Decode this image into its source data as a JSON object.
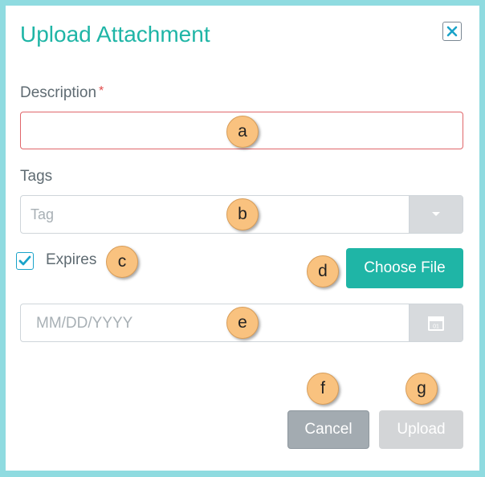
{
  "dialog": {
    "title": "Upload Attachment",
    "close_icon": "close-x-icon"
  },
  "form": {
    "description_label": "Description",
    "required_mark": "*",
    "description_value": "",
    "tags_label": "Tags",
    "tags_placeholder": "Tag",
    "expires_label": "Expires",
    "expires_checked": true,
    "choose_file_label": "Choose File",
    "date_placeholder": "MM/DD/YYYY",
    "calendar_icon_text": "01"
  },
  "footer": {
    "cancel_label": "Cancel",
    "upload_label": "Upload"
  },
  "annotations": {
    "a": "a",
    "b": "b",
    "c": "c",
    "d": "d",
    "e": "e",
    "f": "f",
    "g": "g"
  },
  "colors": {
    "accent": "#1fb5a6",
    "frame": "#8fdbe0",
    "error_border": "#e0666a",
    "marker": "#f9c27f"
  }
}
